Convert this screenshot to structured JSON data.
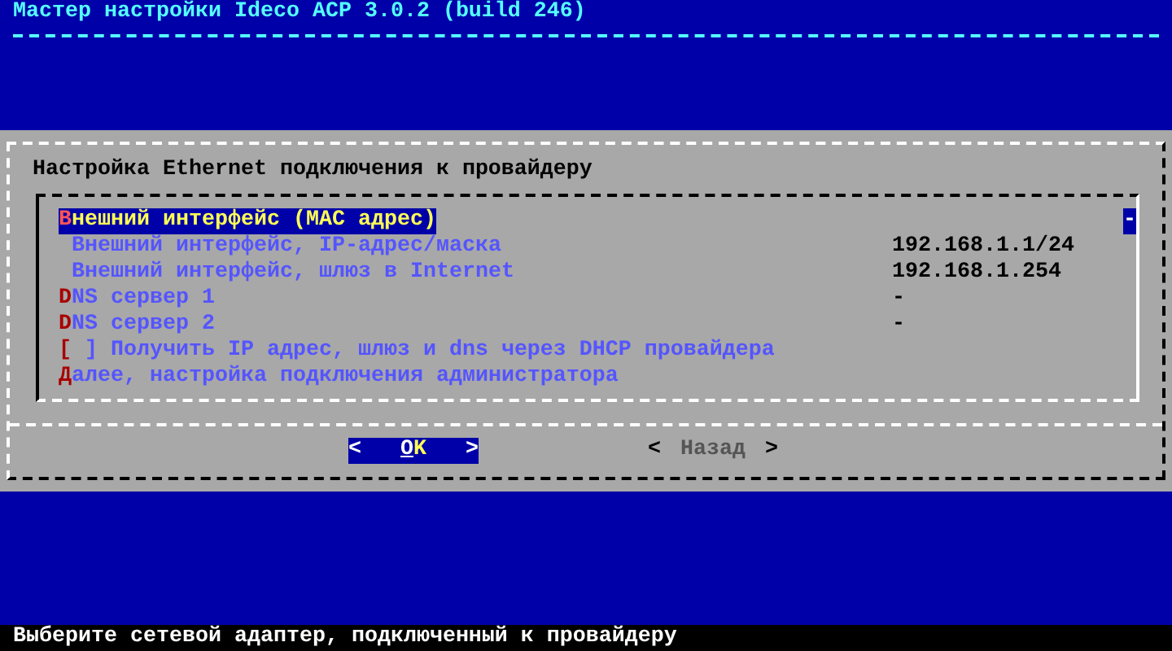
{
  "header": {
    "title": "Мастер настройки Ideco ACP 3.0.2 (build 246)"
  },
  "dialog": {
    "title": "Настройка Ethernet подключения к провайдеру",
    "items": [
      {
        "hotkey": "В",
        "label": "нешний интерфейс (MAC адрес)",
        "value": "-",
        "selected": true
      },
      {
        "label": "Внешний интерфейс, IP-адрес/маска",
        "value": "192.168.1.1/24",
        "selected": false
      },
      {
        "label": "Внешний интерфейс, шлюз в Internet",
        "value": "192.168.1.254",
        "selected": false
      },
      {
        "hotkey": "D",
        "label": "NS сервер 1",
        "value": "-",
        "selected": false
      },
      {
        "hotkey": "D",
        "label": "NS сервер 2",
        "value": "-",
        "selected": false
      },
      {
        "hotkey": "[",
        "label": " ] Получить IP адрес, шлюз и dns через DHCP провайдера",
        "selected": false
      },
      {
        "hotkey": "Д",
        "label": "алее, настройка подключения администратора",
        "selected": false
      }
    ],
    "buttons": [
      {
        "open": "<",
        "hotkey": "O",
        "label": "K",
        "close": ">",
        "selected": true
      },
      {
        "open": "<",
        "label": "Назад",
        "close": ">",
        "selected": false
      }
    ]
  },
  "status_bar": "Выберите сетевой адаптер, подключенный к провайдеру"
}
